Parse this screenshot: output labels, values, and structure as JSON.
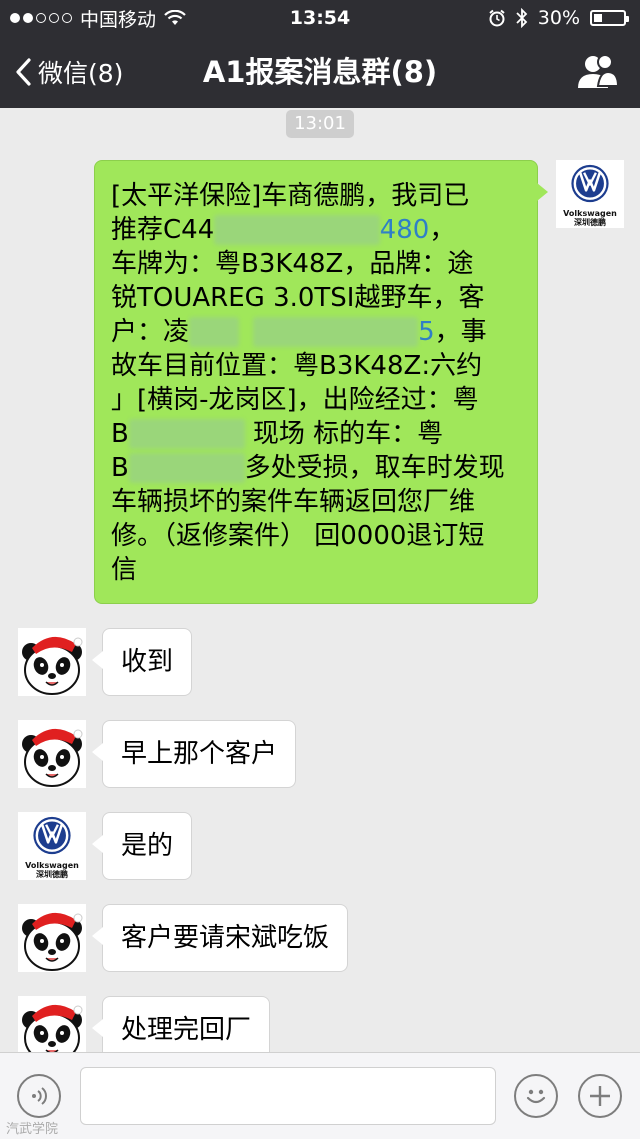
{
  "status_bar": {
    "carrier": "中国移动",
    "time": "13:54",
    "battery": "30%",
    "battery_level": 0.3,
    "signal_bars_filled": 2,
    "signal_bars_total": 5
  },
  "nav": {
    "back_label": "微信(8)",
    "title": "A1报案消息群(8)",
    "group_icon": "group-people-icon"
  },
  "chat": {
    "timestamp": "13:01",
    "incoming_text": {
      "l1": "[太平洋保险]车商德鹏，我司已",
      "l2a": "推荐C44",
      "l2c": "480",
      "l2d": "，",
      "l3": "车牌为：粤B3K48Z，品牌：途",
      "l4": "锐TOUAREG 3.0TSI越野车，客",
      "l5a": "户：凌",
      "l5c": "5",
      "l5d": "，事",
      "l6": "故车目前位置：粤B3K48Z:六约",
      "l7": "」[横岗-龙岗区]，出险经过：粤",
      "l8a": "B",
      "l8c": " 现场  标的车：粤",
      "l9a": "B",
      "l9c": "多处受损，取车时发现",
      "l10": "车辆损坏的案件车辆返回您厂维",
      "l11": "修。（返修案件） 回0000退订短",
      "l12": "信"
    },
    "messages": [
      {
        "text": "收到",
        "avatar": "panda-avatar"
      },
      {
        "text": "早上那个客户",
        "avatar": "panda-avatar"
      },
      {
        "text": "是的",
        "avatar": "vw-avatar"
      },
      {
        "text": "客户要请宋斌吃饭",
        "avatar": "panda-avatar"
      },
      {
        "text": "处理完回厂",
        "avatar": "panda-avatar"
      }
    ],
    "vw_logo_text": "Volkswagen",
    "vw_dealer_text": "深圳德鹏"
  },
  "input_bar": {
    "voice_icon": "voice-icon",
    "emoji_icon": "emoji-icon",
    "plus_icon": "plus-icon",
    "input_value": ""
  },
  "watermark": "汽武学院",
  "colors": {
    "bar_bg": "#2e2e33",
    "chat_bg": "#ebebeb",
    "my_bubble": "#a0e75a",
    "link": "#2f7fc7"
  }
}
